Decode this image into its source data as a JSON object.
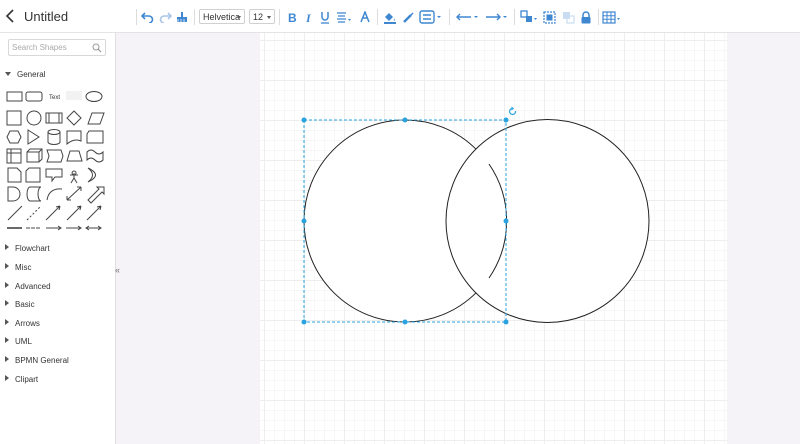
{
  "app": {
    "title": "Untitled"
  },
  "toolbar": {
    "font_family": "Helvetica",
    "font_size": "12",
    "icons": [
      "undo-icon",
      "redo-icon",
      "format-painter-icon",
      "bold-icon",
      "italic-icon",
      "underline-icon",
      "align-icon",
      "font-color-icon",
      "fill-color-icon",
      "line-color-icon",
      "line-style-icon",
      "arrow-start-icon",
      "arrow-end-icon",
      "arrange-icon",
      "group-icon",
      "ungroup-icon",
      "lock-icon",
      "table-icon"
    ],
    "accent_color": "#3f87d1"
  },
  "sidebar": {
    "search_placeholder": "Search Shapes",
    "palette_text_label": "Text",
    "categories": [
      {
        "label": "General",
        "expanded": true
      },
      {
        "label": "Flowchart",
        "expanded": false
      },
      {
        "label": "Misc",
        "expanded": false
      },
      {
        "label": "Advanced",
        "expanded": false
      },
      {
        "label": "Basic",
        "expanded": false
      },
      {
        "label": "Arrows",
        "expanded": false
      },
      {
        "label": "UML",
        "expanded": false
      },
      {
        "label": "BPMN General",
        "expanded": false
      },
      {
        "label": "Clipart",
        "expanded": false
      }
    ],
    "collapse_glyph": "«"
  },
  "canvas": {
    "shapes": [
      {
        "type": "circle",
        "selected": true
      },
      {
        "type": "circle",
        "selected": false
      }
    ],
    "selection_color": "#29a3e0"
  }
}
